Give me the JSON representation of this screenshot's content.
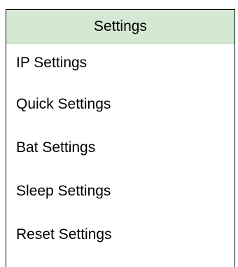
{
  "settings_menu": {
    "title": "Settings",
    "items": [
      {
        "label": "IP Settings"
      },
      {
        "label": "Quick Settings"
      },
      {
        "label": "Bat Settings"
      },
      {
        "label": "Sleep Settings"
      },
      {
        "label": "Reset Settings"
      }
    ]
  },
  "colors": {
    "header_background": "#d5e8d4",
    "header_border": "#82b366",
    "outline": "#000000"
  }
}
